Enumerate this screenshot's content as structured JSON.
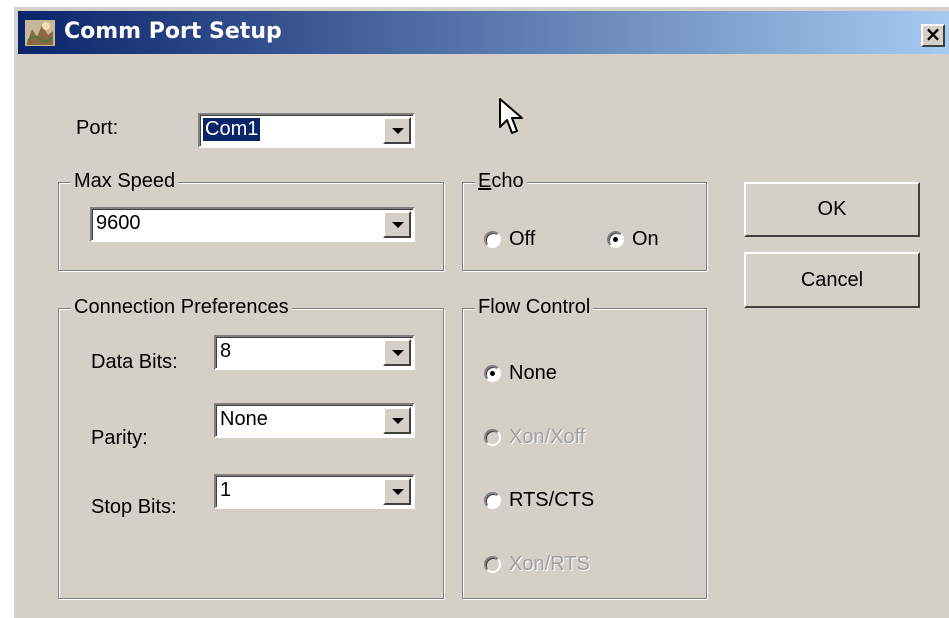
{
  "window": {
    "title": "Comm Port Setup",
    "close_label": "×"
  },
  "port": {
    "label": "Port:",
    "value": "Com1"
  },
  "max_speed": {
    "legend": "Max Speed",
    "value": "9600"
  },
  "echo": {
    "legend_accel": "E",
    "legend_rest": "cho",
    "off_label": "Off",
    "on_label": "On",
    "selected": "On"
  },
  "buttons": {
    "ok": "OK",
    "cancel": "Cancel"
  },
  "connection": {
    "legend": "Connection Preferences",
    "data_bits_label": "Data Bits:",
    "data_bits_value": "8",
    "parity_label": "Parity:",
    "parity_value": "None",
    "stop_bits_label": "Stop Bits:",
    "stop_bits_value": "1"
  },
  "flow_control": {
    "legend": "Flow Control",
    "options": [
      {
        "label": "None",
        "selected": true,
        "enabled": true
      },
      {
        "label": "Xon/Xoff",
        "selected": false,
        "enabled": false
      },
      {
        "label": "RTS/CTS",
        "selected": false,
        "enabled": true
      },
      {
        "label": "Xon/RTS",
        "selected": false,
        "enabled": false
      }
    ]
  },
  "colors": {
    "titlebar_start": "#0a246a",
    "titlebar_end": "#a6caf0",
    "face": "#d4d0c8",
    "selection": "#0a246a"
  }
}
